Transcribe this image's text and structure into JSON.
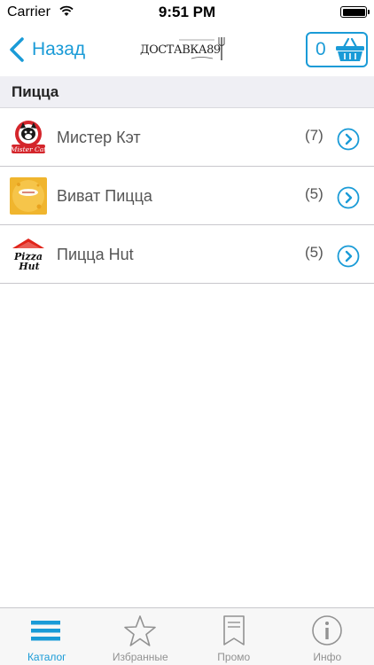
{
  "status_bar": {
    "carrier": "Carrier",
    "time": "9:51 PM"
  },
  "nav": {
    "back_label": "Назад",
    "cart_count": "0",
    "logo_text": "ДОСТАВКА89",
    "accent_color": "#1a9bd7"
  },
  "section": {
    "title": "Пицца"
  },
  "restaurants": [
    {
      "name": "Мистер Кэт",
      "count": "(7)",
      "logo_text": "Mister Cat",
      "icon": "mister-cat-logo"
    },
    {
      "name": "Виват Пицца",
      "count": "(5)",
      "icon": "vivat-pizza-logo"
    },
    {
      "name": "Пицца Hut",
      "count": "(5)",
      "logo_text": "Pizza Hut",
      "icon": "pizza-hut-logo"
    }
  ],
  "tabs": [
    {
      "label": "Каталог",
      "icon": "catalog-icon",
      "active": true
    },
    {
      "label": "Избранные",
      "icon": "star-icon",
      "active": false
    },
    {
      "label": "Промо",
      "icon": "bookmark-icon",
      "active": false
    },
    {
      "label": "Инфо",
      "icon": "info-icon",
      "active": false
    }
  ]
}
